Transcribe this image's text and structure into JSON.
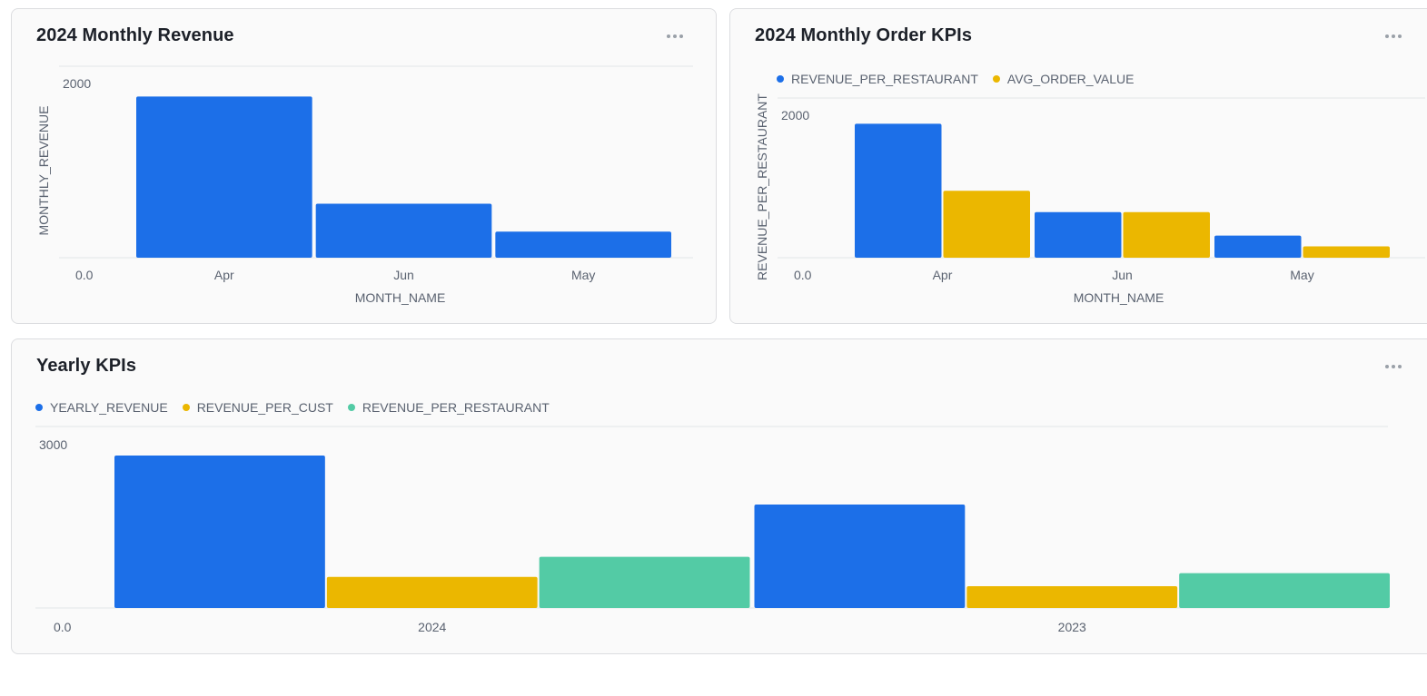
{
  "colors": {
    "blue": "#1c6fe8",
    "yellow": "#ebb700",
    "green": "#53cba5"
  },
  "cards": [
    {
      "title": "2024 Monthly Revenue",
      "more_icon": "more-horizontal-icon",
      "chart_data": {
        "type": "bar",
        "categories": [
          "Apr",
          "Jun",
          "May"
        ],
        "series": [
          {
            "values": [
              1850,
              620,
              300
            ],
            "color": "#1c6fe8"
          }
        ],
        "xlabel": "MONTH_NAME",
        "ylabel": "MONTHLY_REVENUE",
        "y_ticks": [
          "0.0",
          "2000"
        ],
        "ylim": [
          0,
          2000
        ],
        "grid": true,
        "legend": "none"
      }
    },
    {
      "title": "2024 Monthly Order KPIs",
      "more_icon": "more-horizontal-icon",
      "chart_data": {
        "type": "bar",
        "categories": [
          "Apr",
          "Jun",
          "May"
        ],
        "series": [
          {
            "name": "REVENUE_PER_RESTAURANT",
            "values": [
              1880,
              640,
              310
            ],
            "color": "#1c6fe8"
          },
          {
            "name": "AVG_ORDER_VALUE",
            "values": [
              940,
              640,
              160
            ],
            "color": "#ebb700"
          }
        ],
        "xlabel": "MONTH_NAME",
        "ylabel": "REVENUE_PER_RESTAURANT",
        "y_ticks": [
          "0.0",
          "2000"
        ],
        "ylim": [
          0,
          2000
        ],
        "grid": true,
        "legend": "top-left"
      }
    },
    {
      "title": "Yearly KPIs",
      "more_icon": "more-horizontal-icon",
      "chart_data": {
        "type": "bar",
        "categories": [
          "2024",
          "2023"
        ],
        "series": [
          {
            "name": "YEARLY_REVENUE",
            "values": [
              2800,
              1900
            ],
            "color": "#1c6fe8"
          },
          {
            "name": "REVENUE_PER_CUST",
            "values": [
              570,
              400
            ],
            "color": "#ebb700"
          },
          {
            "name": "REVENUE_PER_RESTAURANT",
            "values": [
              940,
              640
            ],
            "color": "#53cba5"
          }
        ],
        "xlabel": "",
        "ylabel": "",
        "y_ticks": [
          "0.0",
          "3000"
        ],
        "ylim": [
          0,
          3000
        ],
        "grid": true,
        "legend": "top-left"
      }
    }
  ]
}
